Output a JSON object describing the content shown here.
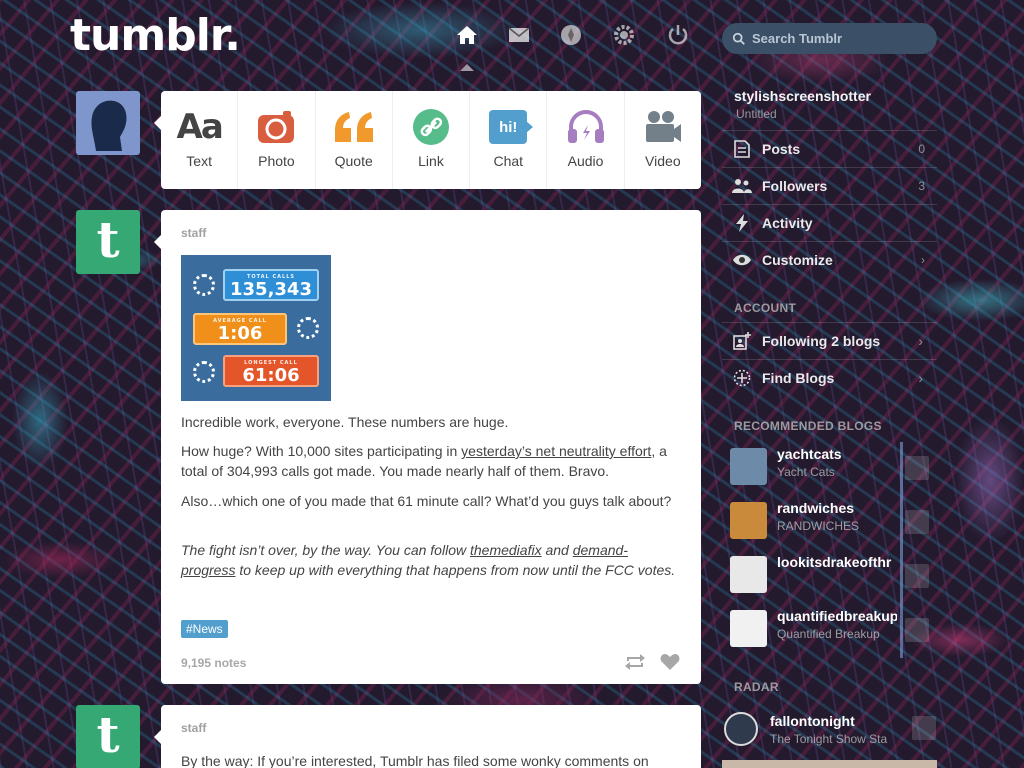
{
  "brand": {
    "logo": "tumblr."
  },
  "nav": {
    "items": [
      "home-icon",
      "inbox-icon",
      "explore-icon",
      "settings-icon",
      "logout-icon"
    ]
  },
  "search": {
    "placeholder": "Search Tumblr"
  },
  "post_types": [
    {
      "label": "Text",
      "icon": "text-icon",
      "glyph": "Aa",
      "color": "#444444"
    },
    {
      "label": "Photo",
      "icon": "camera-icon",
      "color": "#d95e40"
    },
    {
      "label": "Quote",
      "icon": "quote-icon",
      "glyph": "“",
      "color": "#f2992e"
    },
    {
      "label": "Link",
      "icon": "link-icon",
      "color": "#56bc8a"
    },
    {
      "label": "Chat",
      "icon": "chat-icon",
      "glyph": "hi!",
      "color": "#529ecc"
    },
    {
      "label": "Audio",
      "icon": "headphones-icon",
      "color": "#a77dc2"
    },
    {
      "label": "Video",
      "icon": "video-camera-icon",
      "color": "#748089"
    }
  ],
  "posts": [
    {
      "author": "staff",
      "photo": {
        "stats": [
          {
            "caption": "TOTAL CALLS",
            "value": "135,343",
            "color": "#2f8fd6"
          },
          {
            "caption": "AVERAGE CALL",
            "value": "1:06",
            "color": "#f08f1a"
          },
          {
            "caption": "LONGEST CALL",
            "value": "61:06",
            "color": "#e4552a"
          }
        ]
      },
      "p1": "Incredible work, everyone. These numbers are huge.",
      "p2_before": "How huge? With 10,000 sites participating in ",
      "p2_link": "yesterday’s net neutrality effort",
      "p2_after": ", a total of 304,993 calls got made. You made nearly half of them. Bravo.",
      "p3": "Also…which one of you made that 61 minute call? What’d you guys talk about?",
      "p4_before": "The fight isn’t over, by the way. You can follow ",
      "p4_link1": "themediafix",
      "p4_mid": " and ",
      "p4_link2": "demand-progress",
      "p4_after": " to keep up with everything that happens from now until the FCC votes.",
      "tag": "#News",
      "notes": "9,195 notes"
    },
    {
      "author": "staff",
      "text": "By the way: If you’re interested, Tumblr has filed some wonky comments on"
    }
  ],
  "sidebar": {
    "blog_name": "stylishscreenshotter",
    "blog_title": "Untitled",
    "rows": [
      {
        "label": "Posts",
        "count": "0",
        "icon": "posts-icon"
      },
      {
        "label": "Followers",
        "count": "3",
        "icon": "followers-icon"
      },
      {
        "label": "Activity",
        "count": "",
        "icon": "activity-icon"
      },
      {
        "label": "Customize",
        "count": "›",
        "icon": "eye-icon"
      }
    ],
    "account_heading": "ACCOUNT",
    "account_rows": [
      {
        "label": "Following 2 blogs",
        "icon": "following-icon"
      },
      {
        "label": "Find Blogs",
        "icon": "find-blogs-icon"
      }
    ],
    "recommended_heading": "RECOMMENDED BLOGS",
    "recommended": [
      {
        "name": "yachtcats",
        "sub": "Yacht Cats",
        "thumb_color": "#6d8aa8"
      },
      {
        "name": "randwiches",
        "sub": "RANDWICHES",
        "thumb_color": "#c98a3c"
      },
      {
        "name": "lookitsdrakeofthr",
        "sub": "",
        "thumb_color": "#e8e8e8"
      },
      {
        "name": "quantifiedbreakup",
        "sub": "Quantified Breakup",
        "thumb_color": "#f1f1f1"
      }
    ],
    "radar_heading": "RADAR",
    "radar": {
      "name": "fallontonight",
      "sub": "The Tonight Show Sta"
    }
  }
}
